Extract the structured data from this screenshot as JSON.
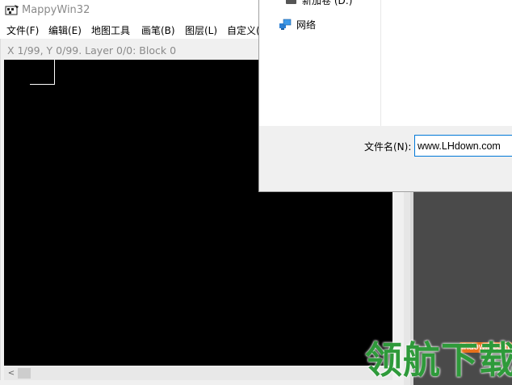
{
  "window": {
    "title": "MappyWin32",
    "menu": [
      "文件(F)",
      "编辑(E)",
      "地图工具",
      "画笔(B)",
      "图层(L)",
      "自定义(U)"
    ]
  },
  "map_view": {
    "status": "X 1/99, Y 0/99. Layer 0/0: Block 0",
    "scroll_left_glyph": "<"
  },
  "file_dialog": {
    "drive_label": "新加卷 (D:)",
    "network_label": "网络",
    "filename_label": "文件名(N):",
    "filename_value": "www.LHdown.com"
  },
  "watermark": {
    "small_text": "lhdown.com",
    "big_text": "领航下载"
  }
}
